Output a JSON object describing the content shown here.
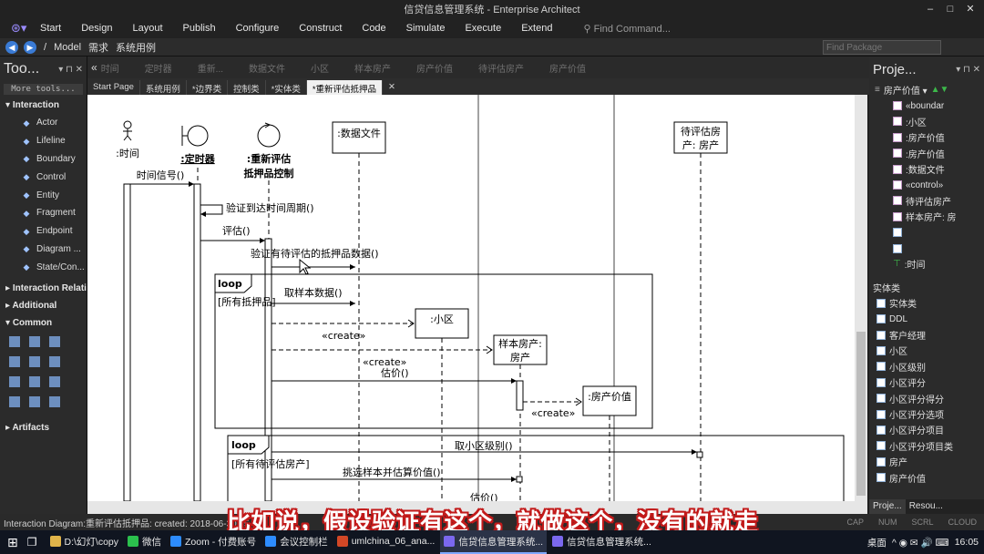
{
  "window": {
    "title": "信贷信息管理系统 - Enterprise Architect"
  },
  "ribbon": {
    "logo": "⊛▾",
    "menus": [
      "Start",
      "Design",
      "Layout",
      "Publish",
      "Configure",
      "Construct",
      "Code",
      "Simulate",
      "Execute",
      "Extend"
    ],
    "find_command": "Find Command..."
  },
  "address": {
    "path": [
      "/",
      "Model",
      "需求",
      "系统用例"
    ],
    "find_package_placeholder": "Find Package"
  },
  "toolbox": {
    "title": "Too...",
    "more_tools": "More tools...",
    "sections": {
      "interaction": "Interaction",
      "interaction_rel": "Interaction Relati",
      "additional": "Additional",
      "common": "Common",
      "artifacts": "Artifacts"
    },
    "items": [
      {
        "label": "Actor",
        "icon": "actor-icon"
      },
      {
        "label": "Lifeline",
        "icon": "lifeline-icon"
      },
      {
        "label": "Boundary",
        "icon": "boundary-icon"
      },
      {
        "label": "Control",
        "icon": "control-icon"
      },
      {
        "label": "Entity",
        "icon": "entity-icon"
      },
      {
        "label": "Fragment",
        "icon": "fragment-icon"
      },
      {
        "label": "Endpoint",
        "icon": "endpoint-icon"
      },
      {
        "label": "Diagram ...",
        "icon": "diagram-icon"
      },
      {
        "label": "State/Con...",
        "icon": "state-icon"
      }
    ]
  },
  "diagram_header": {
    "ghost_labels": [
      "时间",
      "定时器",
      "重新...",
      "数据文件",
      "小区",
      "样本房产",
      "房产价值",
      "待评估房产",
      "房产价值"
    ]
  },
  "tabs": [
    {
      "label": "Start Page"
    },
    {
      "label": "系统用例"
    },
    {
      "label": "*边界类"
    },
    {
      "label": "控制类"
    },
    {
      "label": "*实体类"
    },
    {
      "label": "*重新评估抵押品"
    }
  ],
  "diagram": {
    "lifelines": {
      "timer_actor": ":时间",
      "timer_boundary": ":定时器",
      "reeval_control_1": ":重新评估",
      "reeval_control_2": "抵押品控制",
      "data_file": ":数据文件",
      "community": ":小区",
      "sample_1": "样本房产:",
      "sample_2": "房产",
      "price": ":房产价值",
      "pending_1": "待评估房",
      "pending_2": "产: 房产"
    },
    "messages": {
      "m1": "时间信号()",
      "m2": "验证到达时间周期()",
      "m3": "评估()",
      "m4": "验证有待评估的抵押品数据()",
      "m5": "取样本数据()",
      "m6": "«create»",
      "m7": "«create»",
      "m8": "估价()",
      "m9": "«create»",
      "m10": "取小区级别()",
      "m11": "挑选样本并估算价值()",
      "m12": "估价()"
    },
    "fragments": {
      "loop1": "loop",
      "loop1_guard": "[所有抵押品]",
      "loop2": "loop",
      "loop2_guard": "[所有待评估房产]"
    }
  },
  "project": {
    "title": "Proje...",
    "dropdown": "房产价值 ▾",
    "items": [
      "«boundar",
      ":小区",
      ":房产价值",
      ":房产价值",
      ":数据文件",
      "«control»",
      "待评估房产",
      "样本房产: 房"
    ],
    "extra_item": ":时间",
    "section": "实体类",
    "tree": [
      "实体类",
      "DDL",
      "客户经理",
      "小区",
      "小区级别",
      "小区评分",
      "小区评分得分",
      "小区评分选项",
      "小区评分项目",
      "小区评分项目类",
      "房产",
      "房产价值"
    ],
    "bottom_tabs": [
      "Proje...",
      "Resou..."
    ]
  },
  "status": {
    "text": "Interaction Diagram:重新评估抵押品:  created: 2018-06-30 15",
    "indicators": [
      "CAP",
      "NUM",
      "SCRL",
      "CLOUD"
    ]
  },
  "subtitle": "比如说，假设验证有这个，就做这个，没有的就走",
  "taskbar": {
    "apps": [
      {
        "label": "D:\\幻灯\\copy",
        "color": "#e0b44a"
      },
      {
        "label": "微信",
        "color": "#2bc04d"
      },
      {
        "label": "Zoom - 付费账号",
        "color": "#2d8cff"
      },
      {
        "label": "会议控制栏",
        "color": "#2d8cff"
      },
      {
        "label": "umlchina_06_ana...",
        "color": "#d24726"
      },
      {
        "label": "信贷信息管理系统...",
        "color": "#7b68ee"
      },
      {
        "label": "信贷信息管理系统...",
        "color": "#7b68ee"
      }
    ],
    "right": "桌面",
    "time": "16:05"
  }
}
